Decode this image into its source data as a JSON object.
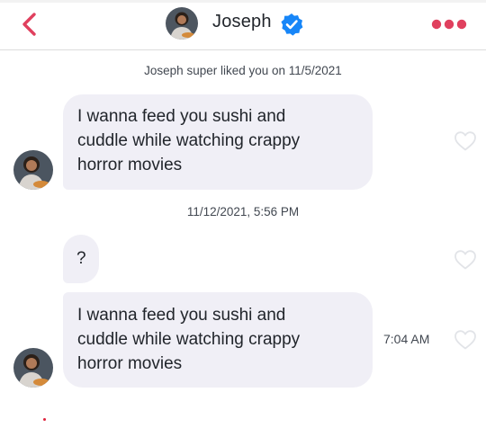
{
  "header": {
    "name": "Joseph",
    "back_icon": "chevron-left-icon",
    "verified_icon": "verified-badge-icon",
    "more_icon": "more-dots-icon",
    "accent_color": "#e0405e",
    "verified_color": "#1786f8"
  },
  "chat": {
    "super_like_notice": "Joseph super liked you on 11/5/2021",
    "timestamp_divider": "11/12/2021, 5:56 PM",
    "messages": [
      {
        "lines": [
          "I wanna feed you sushi and",
          "cuddle while watching crappy",
          "horror movies"
        ],
        "time": "",
        "liked": false
      },
      {
        "lines": [
          "?"
        ],
        "time": "",
        "liked": false
      },
      {
        "lines": [
          "I wanna feed you sushi and",
          "cuddle while watching crappy",
          "horror movies"
        ],
        "time": "7:04 AM",
        "liked": false
      }
    ]
  }
}
